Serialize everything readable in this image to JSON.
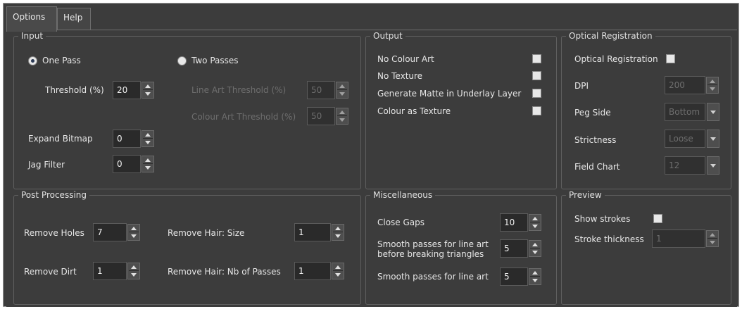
{
  "tabs": [
    {
      "label": "Options",
      "active": true
    },
    {
      "label": "Help",
      "active": false
    }
  ],
  "input": {
    "title": "Input",
    "one_pass": {
      "label": "One Pass",
      "selected": true
    },
    "two_passes": {
      "label": "Two Passes",
      "selected": false
    },
    "threshold": {
      "label": "Threshold (%)",
      "value": "20"
    },
    "line_art_threshold": {
      "label": "Line Art Threshold (%)",
      "value": "50"
    },
    "colour_art_threshold": {
      "label": "Colour Art Threshold (%)",
      "value": "50"
    },
    "expand_bitmap": {
      "label": "Expand Bitmap",
      "value": "0"
    },
    "jag_filter": {
      "label": "Jag Filter",
      "value": "0"
    }
  },
  "output": {
    "title": "Output",
    "no_colour_art": {
      "label": "No Colour Art",
      "checked": false
    },
    "no_texture": {
      "label": "No Texture",
      "checked": false
    },
    "generate_matte": {
      "label": "Generate Matte in Underlay Layer",
      "checked": false
    },
    "colour_as_texture": {
      "label": "Colour as Texture",
      "checked": false
    }
  },
  "optical": {
    "title": "Optical Registration",
    "enable": {
      "label": "Optical Registration",
      "checked": false
    },
    "dpi": {
      "label": "DPI",
      "value": "200"
    },
    "peg_side": {
      "label": "Peg Side",
      "value": "Bottom"
    },
    "strictness": {
      "label": "Strictness",
      "value": "Loose"
    },
    "field_chart": {
      "label": "Field Chart",
      "value": "12"
    }
  },
  "post": {
    "title": "Post Processing",
    "remove_holes": {
      "label": "Remove Holes",
      "value": "7"
    },
    "remove_dirt": {
      "label": "Remove Dirt",
      "value": "1"
    },
    "hair_size": {
      "label": "Remove Hair: Size",
      "value": "1"
    },
    "hair_passes": {
      "label": "Remove Hair: Nb of Passes",
      "value": "1"
    }
  },
  "misc": {
    "title": "Miscellaneous",
    "close_gaps": {
      "label": "Close Gaps",
      "value": "10"
    },
    "smooth_before": {
      "label_line1": "Smooth passes for line art",
      "label_line2": "before breaking triangles",
      "value": "5"
    },
    "smooth": {
      "label": "Smooth passes for line art",
      "value": "5"
    }
  },
  "preview": {
    "title": "Preview",
    "show_strokes": {
      "label": "Show strokes",
      "checked": false
    },
    "stroke_thickness": {
      "label": "Stroke thickness",
      "value": "1"
    }
  }
}
